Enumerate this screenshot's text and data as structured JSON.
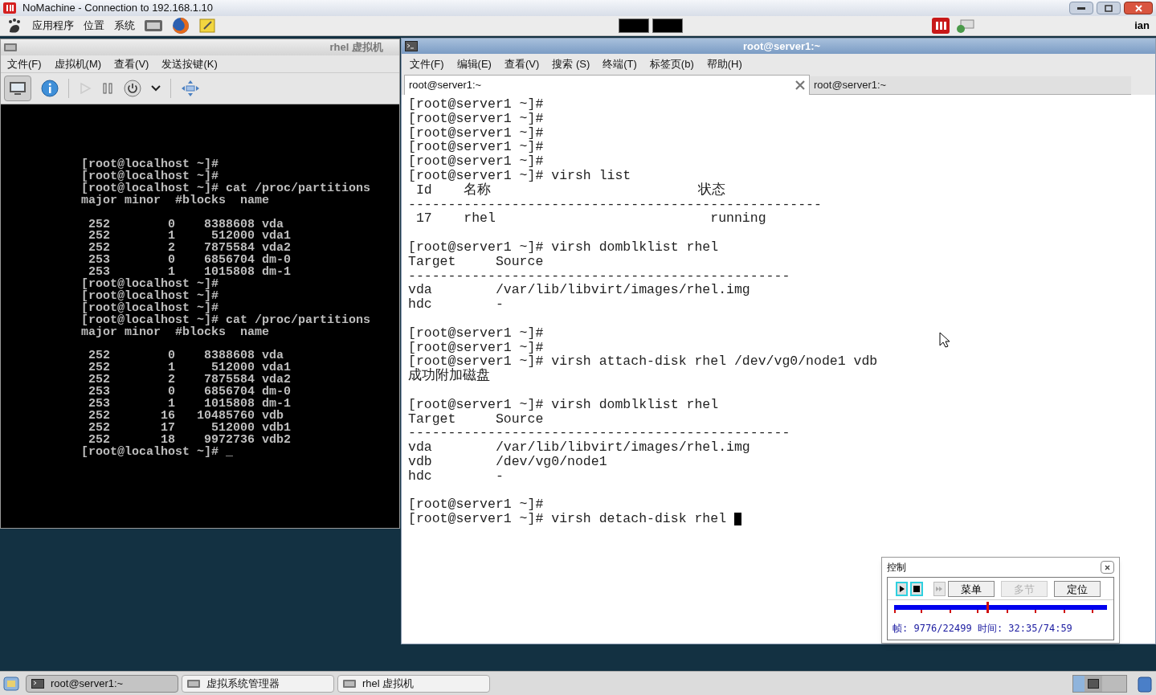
{
  "app_window": {
    "title": "NoMachine - Connection to 192.168.1.10"
  },
  "top_panel": {
    "menus": [
      "应用程序",
      "位置",
      "系统"
    ],
    "user": "ian"
  },
  "vm_window": {
    "title": "rhel 虚拟机",
    "menu": [
      "文件(F)",
      "虚拟机(M)",
      "查看(V)",
      "发送按键(K)"
    ],
    "console_blocks": [
      [
        "[root@localhost ~]#",
        "[root@localhost ~]#",
        "[root@localhost ~]# cat /proc/partitions",
        "major minor  #blocks  name"
      ],
      [
        " 252        0    8388608 vda",
        " 252        1     512000 vda1",
        " 252        2    7875584 vda2",
        " 253        0    6856704 dm-0",
        " 253        1    1015808 dm-1",
        "[root@localhost ~]#",
        "[root@localhost ~]#",
        "[root@localhost ~]#",
        "[root@localhost ~]# cat /proc/partitions",
        "major minor  #blocks  name"
      ],
      [
        " 252        0    8388608 vda",
        " 252        1     512000 vda1",
        " 252        2    7875584 vda2",
        " 253        0    6856704 dm-0",
        " 253        1    1015808 dm-1",
        " 252       16   10485760 vdb",
        " 252       17     512000 vdb1",
        " 252       18    9972736 vdb2",
        "[root@localhost ~]# _"
      ]
    ]
  },
  "terminal_window": {
    "title": "root@server1:~",
    "menu": [
      "文件(F)",
      "编辑(E)",
      "查看(V)",
      "搜索 (S)",
      "终端(T)",
      "标签页(b)",
      "帮助(H)"
    ],
    "tabs": [
      {
        "label": "root@server1:~",
        "selected": true
      },
      {
        "label": "root@server1:~",
        "selected": false
      }
    ],
    "blocks": [
      [
        "[root@server1 ~]#",
        "[root@server1 ~]#",
        "[root@server1 ~]#",
        "[root@server1 ~]#",
        "[root@server1 ~]#",
        "[root@server1 ~]# virsh list",
        " Id    名称                          状态",
        "----------------------------------------------------",
        " 17    rhel                           running"
      ],
      [
        "[root@server1 ~]# virsh domblklist rhel",
        "Target     Source",
        "------------------------------------------------",
        "vda        /var/lib/libvirt/images/rhel.img",
        "hdc        -"
      ],
      [
        "[root@server1 ~]#",
        "[root@server1 ~]#",
        "[root@server1 ~]# virsh attach-disk rhel /dev/vg0/node1 vdb",
        "成功附加磁盘"
      ],
      [
        "[root@server1 ~]# virsh domblklist rhel",
        "Target     Source",
        "------------------------------------------------",
        "vda        /var/lib/libvirt/images/rhel.img",
        "vdb        /dev/vg0/node1",
        "hdc        -"
      ],
      [
        "[root@server1 ~]#",
        "[root@server1 ~]# virsh detach-disk rhel "
      ]
    ]
  },
  "control_panel": {
    "title": "控制",
    "buttons": [
      {
        "label": "菜单",
        "disabled": false
      },
      {
        "label": "多节",
        "disabled": true
      },
      {
        "label": "定位",
        "disabled": false
      }
    ],
    "level": 0.434,
    "status": "帧: 9776/22499 时间: 32:35/74:59"
  },
  "taskbar": {
    "items": [
      {
        "label": "root@server1:~",
        "selected": true
      },
      {
        "label": "虚拟系统管理器",
        "selected": false
      },
      {
        "label": "rhel 虚拟机",
        "selected": false
      }
    ]
  }
}
